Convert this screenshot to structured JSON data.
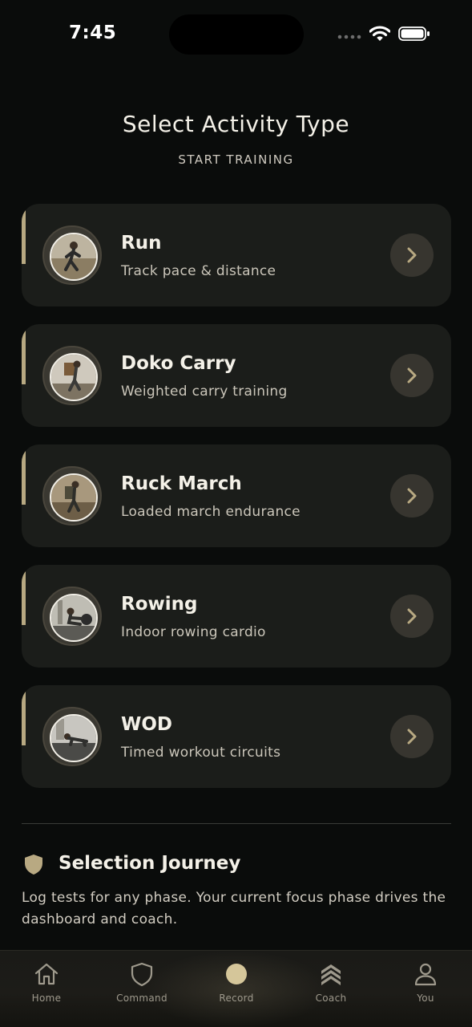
{
  "status": {
    "time": "7:45"
  },
  "header": {
    "title": "Select Activity Type",
    "subtitle": "START TRAINING"
  },
  "activities": [
    {
      "title": "Run",
      "description": "Track pace & distance"
    },
    {
      "title": "Doko Carry",
      "description": "Weighted carry training"
    },
    {
      "title": "Ruck March",
      "description": "Loaded march endurance"
    },
    {
      "title": "Rowing",
      "description": "Indoor rowing cardio"
    },
    {
      "title": "WOD",
      "description": "Timed workout circuits"
    }
  ],
  "journey": {
    "title": "Selection Journey",
    "text": "Log tests for any phase. Your current focus phase drives the dashboard and coach."
  },
  "tabs": [
    {
      "label": "Home",
      "icon": "home-icon"
    },
    {
      "label": "Command",
      "icon": "shield-icon"
    },
    {
      "label": "Record",
      "icon": "record-icon"
    },
    {
      "label": "Coach",
      "icon": "chevrons-up-icon"
    },
    {
      "label": "You",
      "icon": "user-icon"
    }
  ],
  "colors": {
    "accent": "#b8a982",
    "background": "#0a0c0b",
    "card": "#1b1d1a"
  }
}
